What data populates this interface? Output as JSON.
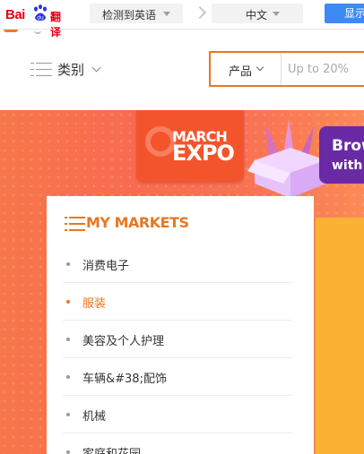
{
  "translate_bar": {
    "logo_bai": "Bai",
    "logo_du": "du",
    "logo_fanyi": "翻译",
    "detect_label": "检测到英语",
    "target_lang": "中文",
    "show_button": "显示"
  },
  "header": {
    "category_label": "类别",
    "search_type": "产品",
    "search_placeholder": "Up to 20%"
  },
  "banner": {
    "expo_line1": "MARCH",
    "expo_line2": "EXPO",
    "promo_line1": "Brow",
    "promo_line2": "with"
  },
  "markets": {
    "title": "MY MARKETS",
    "items": [
      {
        "label": "消费电子"
      },
      {
        "label": "服装"
      },
      {
        "label": "美容及个人护理"
      },
      {
        "label": "车辆&#38;配饰"
      },
      {
        "label": "机械"
      },
      {
        "label": "家庭和花园"
      }
    ],
    "active_index": 1
  },
  "colors": {
    "accent": "#e87722",
    "baidu_red": "#e60012",
    "translate_blue": "#3d8af7",
    "banner_red": "#f86b50",
    "expo_orange": "#f4542b",
    "promo_purple": "#6a2aa5",
    "yellow": "#f9b233"
  },
  "icons": [
    "baidu-paw-icon",
    "caret-down-icon",
    "swap-arrow-icon",
    "menu-icon",
    "chevron-down-icon",
    "gift-box-icon",
    "list-icon",
    "bullet-icon"
  ]
}
